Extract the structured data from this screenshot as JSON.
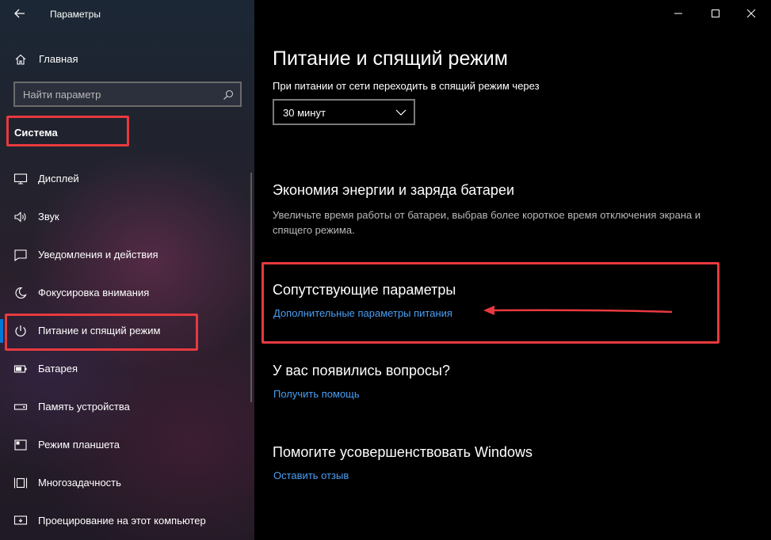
{
  "window": {
    "title": "Параметры",
    "minimize_icon": "minimize-icon",
    "maximize_icon": "maximize-icon",
    "close_icon": "close-icon"
  },
  "sidebar": {
    "home_label": "Главная",
    "search_placeholder": "Найти параметр",
    "section_title": "Система",
    "items": [
      {
        "label": "Дисплей",
        "icon": "display-icon"
      },
      {
        "label": "Звук",
        "icon": "sound-icon"
      },
      {
        "label": "Уведомления и действия",
        "icon": "notifications-icon"
      },
      {
        "label": "Фокусировка внимания",
        "icon": "focus-assist-icon"
      },
      {
        "label": "Питание и спящий режим",
        "icon": "power-icon",
        "active": true
      },
      {
        "label": "Батарея",
        "icon": "battery-icon"
      },
      {
        "label": "Память устройства",
        "icon": "storage-icon"
      },
      {
        "label": "Режим планшета",
        "icon": "tablet-mode-icon"
      },
      {
        "label": "Многозадачность",
        "icon": "multitasking-icon"
      },
      {
        "label": "Проецирование на этот компьютер",
        "icon": "projecting-icon"
      }
    ]
  },
  "main": {
    "title": "Питание и спящий режим",
    "sleep": {
      "label": "При питании от сети переходить в спящий режим через",
      "value": "30 минут"
    },
    "battery_saver": {
      "heading": "Экономия энергии и заряда батареи",
      "description": "Увеличьте время работы от батареи, выбрав более короткое время отключения экрана и спящего режима."
    },
    "related": {
      "heading": "Сопутствующие параметры",
      "link": "Дополнительные параметры питания"
    },
    "questions": {
      "heading": "У вас появились вопросы?",
      "link": "Получить помощь"
    },
    "improve": {
      "heading": "Помогите усовершенствовать Windows",
      "link": "Оставить отзыв"
    }
  },
  "colors": {
    "accent": "#0078d7",
    "link": "#4a9ff5",
    "highlight": "#e8393f"
  }
}
